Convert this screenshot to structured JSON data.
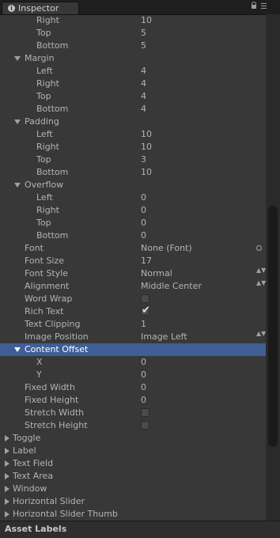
{
  "tab": {
    "label": "Inspector",
    "info_glyph": "i"
  },
  "footer": {
    "title": "Asset Labels"
  },
  "rows": [
    {
      "label": "Right",
      "value": "10"
    },
    {
      "label": "Top",
      "value": "5"
    },
    {
      "label": "Bottom",
      "value": "5"
    },
    {
      "label": "Margin"
    },
    {
      "label": "Left",
      "value": "4"
    },
    {
      "label": "Right",
      "value": "4"
    },
    {
      "label": "Top",
      "value": "4"
    },
    {
      "label": "Bottom",
      "value": "4"
    },
    {
      "label": "Padding"
    },
    {
      "label": "Left",
      "value": "10"
    },
    {
      "label": "Right",
      "value": "10"
    },
    {
      "label": "Top",
      "value": "3"
    },
    {
      "label": "Bottom",
      "value": "10"
    },
    {
      "label": "Overflow"
    },
    {
      "label": "Left",
      "value": "0"
    },
    {
      "label": "Right",
      "value": "0"
    },
    {
      "label": "Top",
      "value": "0"
    },
    {
      "label": "Bottom",
      "value": "0"
    },
    {
      "label": "Font",
      "value": "None (Font)"
    },
    {
      "label": "Font Size",
      "value": "17"
    },
    {
      "label": "Font Style",
      "value": "Normal"
    },
    {
      "label": "Alignment",
      "value": "Middle Center"
    },
    {
      "label": "Word Wrap",
      "checked": false
    },
    {
      "label": "Rich Text",
      "checked": true
    },
    {
      "label": "Text Clipping",
      "value": "1"
    },
    {
      "label": "Image Position",
      "value": "Image Left"
    },
    {
      "label": "Content Offset"
    },
    {
      "label": "X",
      "value": "0"
    },
    {
      "label": "Y",
      "value": "0"
    },
    {
      "label": "Fixed Width",
      "value": "0"
    },
    {
      "label": "Fixed Height",
      "value": "0"
    },
    {
      "label": "Stretch Width",
      "checked": false
    },
    {
      "label": "Stretch Height",
      "checked": false
    },
    {
      "label": "Toggle"
    },
    {
      "label": "Label"
    },
    {
      "label": "Text Field"
    },
    {
      "label": "Text Area"
    },
    {
      "label": "Window"
    },
    {
      "label": "Horizontal Slider"
    },
    {
      "label": "Horizontal Slider Thumb"
    }
  ],
  "checkmark_glyph": "✔",
  "updown_glyph": "▲▼"
}
